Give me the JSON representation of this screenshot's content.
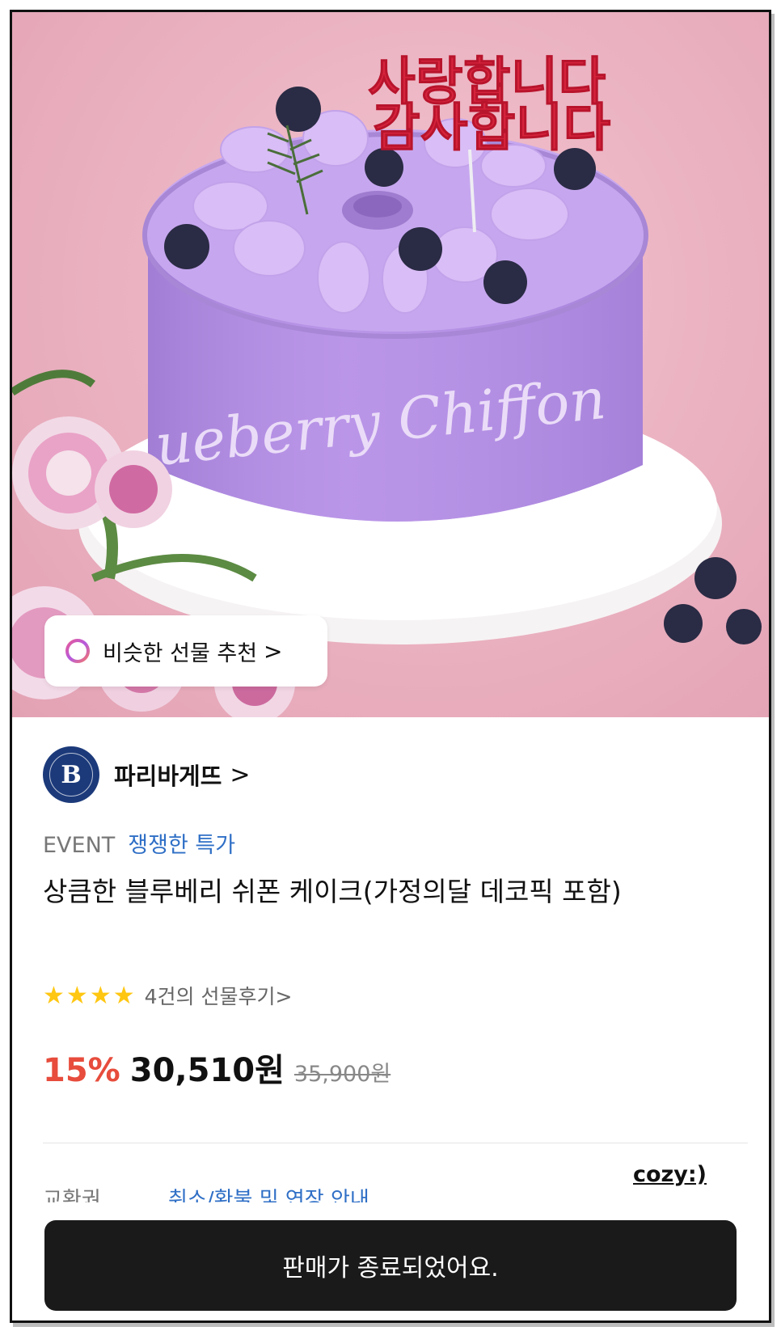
{
  "hero": {
    "topper_line1": "사랑합니다",
    "topper_line2": "감사합니다",
    "cake_script": "ueberry Chiffon",
    "recommend_label": "비슷한 선물 추천",
    "recommend_chevron": ">"
  },
  "brand": {
    "logo_letter": "B",
    "name": "파리바게뜨",
    "chevron": ">"
  },
  "event": {
    "tag": "EVENT",
    "text": "쟁쟁한 특가"
  },
  "product": {
    "title": "상큼한 블루베리 쉬폰 케이크(가정의달 데코픽 포함)"
  },
  "reviews": {
    "rating": 4,
    "text": "4건의 선물후기>"
  },
  "price": {
    "discount": "15%",
    "current": "30,510원",
    "original": "35,900원"
  },
  "info": {
    "label": "교환권",
    "link": "취소/환불 및 연장 안내"
  },
  "watermark": "cozy:)",
  "bottom_button": {
    "label": "판매가 종료되었어요."
  },
  "colors": {
    "accent_red": "#e74c3c",
    "link_blue": "#2f6fc6",
    "star_yellow": "#ffc712",
    "button_dark": "#1a1a1a"
  }
}
